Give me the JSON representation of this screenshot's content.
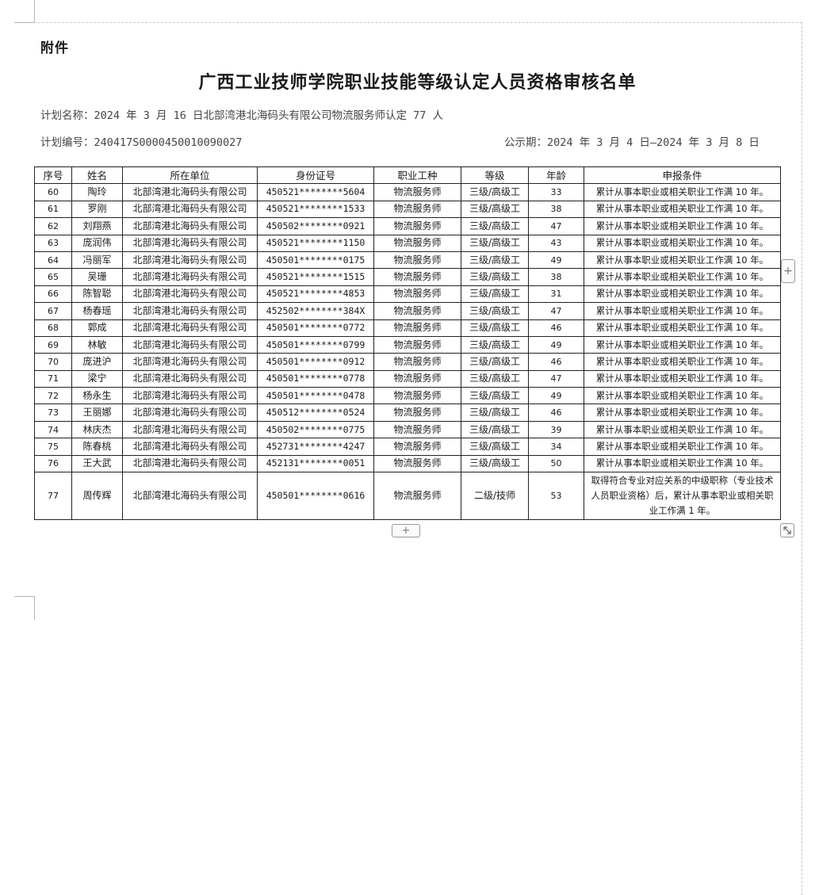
{
  "attachment_label": "附件",
  "title": "广西工业技师学院职业技能等级认定人员资格审核名单",
  "plan": {
    "name_label": "计划名称：",
    "name_value": "2024 年 3 月 16 日北部湾港北海码头有限公司物流服务师认定 77 人",
    "id_label": "计划编号：",
    "id_value": "240417S000045001009002​7",
    "publicity_label": "公示期：",
    "publicity_value": "2024 年 3 月 4 日—2024 年 3 月 8 日"
  },
  "table": {
    "headers": [
      "序号",
      "姓名",
      "所在单位",
      "身份证号",
      "职业工种",
      "等级",
      "年龄",
      "申报条件"
    ],
    "rows": [
      [
        "60",
        "陶玲",
        "北部湾港北海码头有限公司",
        "450521********5604",
        "物流服务师",
        "三级/高级工",
        "33",
        "累计从事本职业或相关职业工作满 10 年。"
      ],
      [
        "61",
        "罗刚",
        "北部湾港北海码头有限公司",
        "450521********1533",
        "物流服务师",
        "三级/高级工",
        "38",
        "累计从事本职业或相关职业工作满 10 年。"
      ],
      [
        "62",
        "刘翔燕",
        "北部湾港北海码头有限公司",
        "450502********0921",
        "物流服务师",
        "三级/高级工",
        "47",
        "累计从事本职业或相关职业工作满 10 年。"
      ],
      [
        "63",
        "庞润伟",
        "北部湾港北海码头有限公司",
        "450521********1150",
        "物流服务师",
        "三级/高级工",
        "43",
        "累计从事本职业或相关职业工作满 10 年。"
      ],
      [
        "64",
        "冯丽军",
        "北部湾港北海码头有限公司",
        "450501********0175",
        "物流服务师",
        "三级/高级工",
        "49",
        "累计从事本职业或相关职业工作满 10 年。"
      ],
      [
        "65",
        "吴珊",
        "北部湾港北海码头有限公司",
        "450521********1515",
        "物流服务师",
        "三级/高级工",
        "38",
        "累计从事本职业或相关职业工作满 10 年。"
      ],
      [
        "66",
        "陈智聪",
        "北部湾港北海码头有限公司",
        "450521********4853",
        "物流服务师",
        "三级/高级工",
        "31",
        "累计从事本职业或相关职业工作满 10 年。"
      ],
      [
        "67",
        "杨春瑶",
        "北部湾港北海码头有限公司",
        "452502********384X",
        "物流服务师",
        "三级/高级工",
        "47",
        "累计从事本职业或相关职业工作满 10 年。"
      ],
      [
        "68",
        "郭成",
        "北部湾港北海码头有限公司",
        "450501********0772",
        "物流服务师",
        "三级/高级工",
        "46",
        "累计从事本职业或相关职业工作满 10 年。"
      ],
      [
        "69",
        "林敏",
        "北部湾港北海码头有限公司",
        "450501********0799",
        "物流服务师",
        "三级/高级工",
        "49",
        "累计从事本职业或相关职业工作满 10 年。"
      ],
      [
        "70",
        "庞进沪",
        "北部湾港北海码头有限公司",
        "450501********0912",
        "物流服务师",
        "三级/高级工",
        "46",
        "累计从事本职业或相关职业工作满 10 年。"
      ],
      [
        "71",
        "梁宁",
        "北部湾港北海码头有限公司",
        "450501********0778",
        "物流服务师",
        "三级/高级工",
        "47",
        "累计从事本职业或相关职业工作满 10 年。"
      ],
      [
        "72",
        "杨永生",
        "北部湾港北海码头有限公司",
        "450501********0478",
        "物流服务师",
        "三级/高级工",
        "49",
        "累计从事本职业或相关职业工作满 10 年。"
      ],
      [
        "73",
        "王丽娜",
        "北部湾港北海码头有限公司",
        "450512********0524",
        "物流服务师",
        "三级/高级工",
        "46",
        "累计从事本职业或相关职业工作满 10 年。"
      ],
      [
        "74",
        "林庆杰",
        "北部湾港北海码头有限公司",
        "450502********0775",
        "物流服务师",
        "三级/高级工",
        "39",
        "累计从事本职业或相关职业工作满 10 年。"
      ],
      [
        "75",
        "陈春桃",
        "北部湾港北海码头有限公司",
        "452731********4247",
        "物流服务师",
        "三级/高级工",
        "34",
        "累计从事本职业或相关职业工作满 10 年。"
      ],
      [
        "76",
        "王大武",
        "北部湾港北海码头有限公司",
        "452131********0051",
        "物流服务师",
        "三级/高级工",
        "50",
        "累计从事本职业或相关职业工作满 10 年。"
      ],
      [
        "77",
        "周传辉",
        "北部湾港北海码头有限公司",
        "450501********0616",
        "物流服务师",
        "二级/技师",
        "53",
        "取得符合专业对应关系的中级职称（专业技术人员职业资格）后，累计从事本职业或相关职业工作满 1 年。"
      ]
    ]
  },
  "controls": {
    "add_row_symbol": "+",
    "add_column_symbol": "+",
    "resize_icon": "resize-diagonal-icon"
  }
}
